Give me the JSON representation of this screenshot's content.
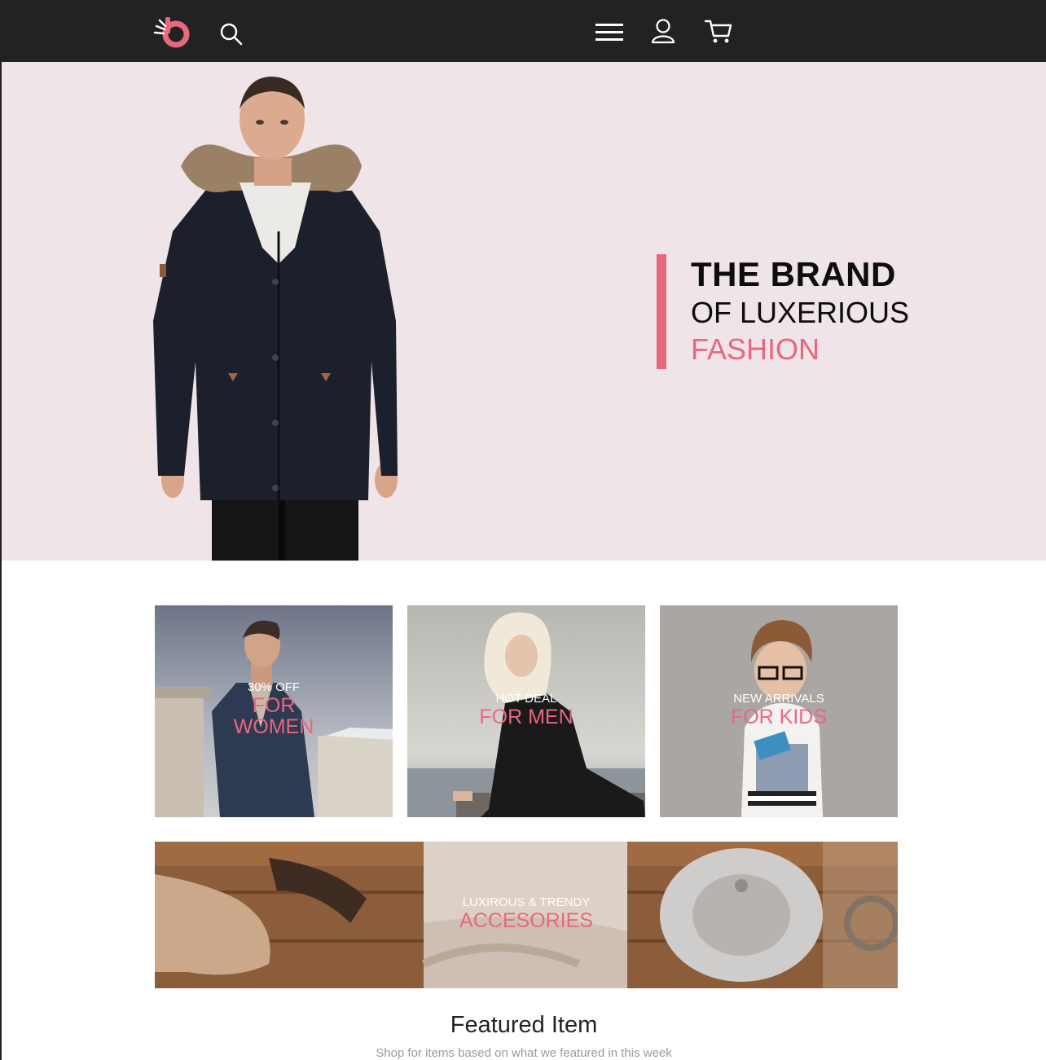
{
  "nav": {
    "icons": [
      "logo-icon",
      "search-icon",
      "menu-icon",
      "user-icon",
      "cart-icon"
    ],
    "accent": "#e8687f",
    "background": "#222224"
  },
  "hero": {
    "line1": "THE BRAND",
    "line2": "OF LUXERIOUS",
    "line3": "FASHION",
    "background": "#efe4e7"
  },
  "categories": [
    {
      "small": "30% OFF",
      "big": "FOR WOMEN"
    },
    {
      "small": "HOT DEAL",
      "big": "FOR MEN"
    },
    {
      "small": "NEW ARRIVALS",
      "big": "FOR KIDS"
    }
  ],
  "banner": {
    "small": "LUXIROUS & TRENDY",
    "big": "ACCESORIES"
  },
  "featured": {
    "title": "Featured Item",
    "subtitle": "Shop for items based on what we featured in this week"
  }
}
